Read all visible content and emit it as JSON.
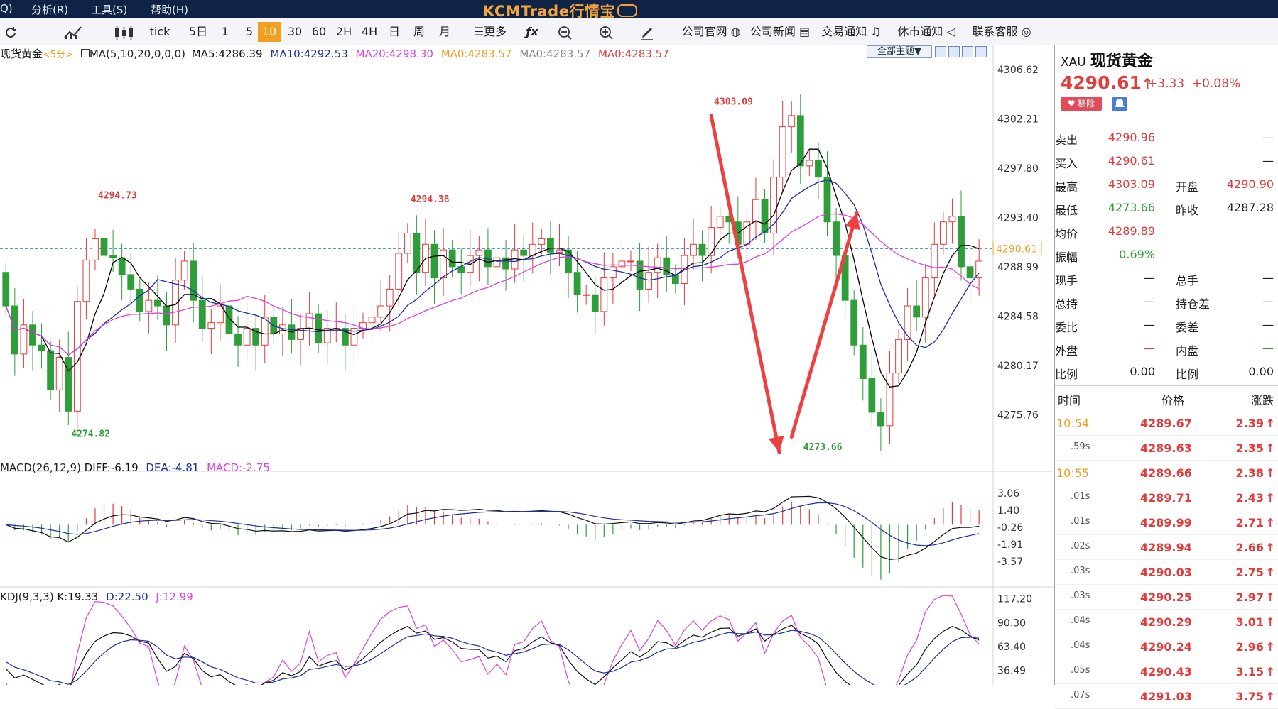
{
  "menubar": {
    "items": [
      "Q)",
      "分析(R)",
      "工具(S)",
      "帮助(H)"
    ],
    "brand": "KCMTrade行情宝"
  },
  "toolbar": {
    "periods": [
      "tick",
      "5日",
      "1",
      "5",
      "10",
      "30",
      "60",
      "2H",
      "4H",
      "日",
      "周",
      "月"
    ],
    "active_period": "10",
    "more": "更多",
    "links": [
      "公司官网",
      "公司新闻",
      "交易通知",
      "休市通知",
      "联系客服"
    ]
  },
  "price_legend": {
    "symbol": "现货黄金",
    "period": "<5分>",
    "ma_def": "MA(5,10,20,0,0,0)",
    "ma5": "MA5:4286.39",
    "ma10": "MA10:4292.53",
    "ma20": "MA20:4298.30",
    "ma0a": "MA0:4283.57",
    "ma0b": "MA0:4283.57",
    "ma0c": "MA0:4283.57",
    "theme_btn": "全部主题▼"
  },
  "macd_legend": {
    "def": "MACD(26,12,9)",
    "diff": "DIFF:-6.19",
    "dea": "DEA:-4.81",
    "macd": "MACD:-2.75"
  },
  "kdj_legend": {
    "def": "KDJ(9,3,3)",
    "k": "K:19.33",
    "d": "D:22.50",
    "j": "J:12.99"
  },
  "colors": {
    "up": "#e23b3b",
    "down": "#2e9e3a",
    "ma5": "#000000",
    "ma10": "#1a2fa8",
    "ma20": "#e040e0",
    "accent": "#f0a020",
    "header": "#0f2346"
  },
  "chart_data": {
    "type": "candlestick",
    "price_axis": {
      "ticks": [
        "4306.62",
        "4302.21",
        "4297.80",
        "4293.40",
        "4288.99",
        "4284.58",
        "4280.17",
        "4275.76"
      ],
      "current": "4290.61",
      "ylim": [
        4272.0,
        4307.5
      ]
    },
    "annotations": [
      {
        "label": "4294.73",
        "bar": 10,
        "price": 4294.73
      },
      {
        "label": "4274.82",
        "bar": 7,
        "price": 4274.82
      },
      {
        "label": "4294.38",
        "bar": 45,
        "price": 4294.38
      },
      {
        "label": "4303.09",
        "bar": 79,
        "price": 4303.09
      },
      {
        "label": "4273.66",
        "bar": 89,
        "price": 4273.66
      }
    ],
    "close": [
      4285.5,
      4281.2,
      4283.8,
      4282.0,
      4281.5,
      4278.0,
      4280.9,
      4276.1,
      4285.9,
      4289.6,
      4291.5,
      4290.0,
      4289.8,
      4288.3,
      4287.0,
      4285.0,
      4286.0,
      4285.5,
      4283.8,
      4287.8,
      4289.5,
      4286.0,
      4283.5,
      4284.0,
      4285.5,
      4283.0,
      4282.0,
      4283.5,
      4282.0,
      4284.5,
      4283.0,
      4283.8,
      4282.5,
      4283.5,
      4284.8,
      4282.2,
      4283.5,
      4283.5,
      4282.0,
      4283.5,
      4284.0,
      4284.5,
      4285.5,
      4287.0,
      4290.2,
      4292.0,
      4288.5,
      4291.0,
      4288.0,
      4290.5,
      4289.0,
      4288.5,
      4290.0,
      4290.5,
      4289.0,
      4289.8,
      4288.8,
      4290.5,
      4290.0,
      4291.0,
      4291.5,
      4290.3,
      4290.5,
      4288.5,
      4286.5,
      4286.5,
      4285.0,
      4288.0,
      4289.0,
      4289.5,
      4289.5,
      4287.0,
      4288.5,
      4289.8,
      4288.3,
      4287.5,
      4290.0,
      4291.0,
      4290.0,
      4292.5,
      4293.5,
      4293.0,
      4291.0,
      4293.0,
      4295.0,
      4292.0,
      4297.0,
      4301.5,
      4302.5,
      4298.0,
      4298.5,
      4297.0,
      4293.0,
      4290.0,
      4286.0,
      4282.0,
      4279.0,
      4276.0,
      4274.8,
      4279.5,
      4282.5,
      4285.5,
      4284.5,
      4288.0,
      4291.0,
      4293.0,
      4293.5,
      4289.0,
      4288.0,
      4289.5
    ],
    "open": [
      4288.5,
      4285.5,
      4281.2,
      4283.8,
      4282.0,
      4281.5,
      4278.0,
      4280.9,
      4276.1,
      4285.9,
      4289.6,
      4291.5,
      4290.0,
      4289.8,
      4288.3,
      4287.0,
      4285.0,
      4286.0,
      4285.5,
      4283.8,
      4287.8,
      4289.5,
      4286.0,
      4283.5,
      4284.0,
      4285.5,
      4283.0,
      4282.0,
      4283.5,
      4282.0,
      4284.5,
      4283.0,
      4283.8,
      4282.5,
      4283.5,
      4284.8,
      4282.2,
      4283.5,
      4283.5,
      4282.0,
      4283.5,
      4284.0,
      4284.5,
      4285.5,
      4287.0,
      4290.2,
      4292.0,
      4288.5,
      4291.0,
      4288.0,
      4290.5,
      4289.0,
      4288.5,
      4290.0,
      4290.5,
      4289.0,
      4289.8,
      4288.8,
      4290.5,
      4290.0,
      4291.0,
      4291.5,
      4290.3,
      4290.5,
      4288.5,
      4286.5,
      4286.5,
      4285.0,
      4288.0,
      4289.0,
      4289.5,
      4289.5,
      4287.0,
      4288.5,
      4289.8,
      4288.3,
      4287.5,
      4290.0,
      4291.0,
      4290.0,
      4292.5,
      4293.5,
      4293.0,
      4291.0,
      4293.0,
      4295.0,
      4292.0,
      4297.0,
      4301.5,
      4302.5,
      4298.0,
      4298.5,
      4297.0,
      4293.0,
      4290.0,
      4286.0,
      4282.0,
      4279.0,
      4276.0,
      4274.8,
      4279.5,
      4282.5,
      4285.5,
      4284.5,
      4288.0,
      4291.0,
      4293.0,
      4293.5,
      4289.0,
      4288.0
    ],
    "macd_axis": [
      "3.06",
      "1.40",
      "-0.26",
      "-1.91",
      "-3.57"
    ],
    "macd_ylim": [
      -5.0,
      4.5
    ],
    "kdj_axis": [
      "117.20",
      "90.30",
      "63.40",
      "36.49"
    ],
    "kdj_ylim": [
      20,
      125
    ]
  },
  "quote": {
    "code": "XAU",
    "name": "现货黄金",
    "price": "4290.61",
    "arrow": "↑",
    "change": "+3.33",
    "change_pct": "+0.08%",
    "remove_btn": "♥ 移除",
    "rows": [
      {
        "l1": "卖出",
        "v1": "4290.96",
        "l2": "",
        "v2": "—",
        "c1": "red",
        "c2": ""
      },
      {
        "l1": "买入",
        "v1": "4290.61",
        "l2": "",
        "v2": "—",
        "c1": "red",
        "c2": ""
      },
      {
        "l1": "最高",
        "v1": "4303.09",
        "l2": "开盘",
        "v2": "4290.90",
        "c1": "red",
        "c2": "red"
      },
      {
        "l1": "最低",
        "v1": "4273.66",
        "l2": "昨收",
        "v2": "4287.28",
        "c1": "green",
        "c2": ""
      },
      {
        "l1": "均价",
        "v1": "4289.89",
        "l2": "",
        "v2": "",
        "c1": "red",
        "c2": ""
      },
      {
        "l1": "振幅",
        "v1": "0.69%",
        "l2": "",
        "v2": "",
        "c1": "green",
        "c2": ""
      },
      {
        "l1": "现手",
        "v1": "—",
        "l2": "总手",
        "v2": "—",
        "c1": "",
        "c2": ""
      },
      {
        "l1": "总持",
        "v1": "—",
        "l2": "持仓差",
        "v2": "—",
        "c1": "",
        "c2": ""
      },
      {
        "l1": "委比",
        "v1": "—",
        "l2": "委差",
        "v2": "—",
        "c1": "",
        "c2": ""
      },
      {
        "l1": "外盘",
        "v1": "—",
        "l2": "内盘",
        "v2": "—",
        "c1": "red",
        "c2": "green"
      },
      {
        "l1": "比例",
        "v1": "0.00",
        "l2": "比例",
        "v2": "0.00",
        "c1": "",
        "c2": ""
      }
    ],
    "tick_header": {
      "time": "时间",
      "price": "价格",
      "change": "涨跌"
    },
    "ticks": [
      {
        "time": "10:54",
        "price": "4289.67",
        "change": "2.39",
        "hl": true
      },
      {
        "time": ".59s",
        "price": "4289.63",
        "change": "2.35",
        "hl": false
      },
      {
        "time": "10:55",
        "price": "4289.66",
        "change": "2.38",
        "hl": true
      },
      {
        "time": ".01s",
        "price": "4289.71",
        "change": "2.43",
        "hl": false
      },
      {
        "time": ".01s",
        "price": "4289.99",
        "change": "2.71",
        "hl": false
      },
      {
        "time": ".02s",
        "price": "4289.94",
        "change": "2.66",
        "hl": false
      },
      {
        "time": ".03s",
        "price": "4290.03",
        "change": "2.75",
        "hl": false
      },
      {
        "time": ".03s",
        "price": "4290.25",
        "change": "2.97",
        "hl": false
      },
      {
        "time": ".04s",
        "price": "4290.29",
        "change": "3.01",
        "hl": false
      },
      {
        "time": ".04s",
        "price": "4290.24",
        "change": "2.96",
        "hl": false
      },
      {
        "time": ".05s",
        "price": "4290.43",
        "change": "3.15",
        "hl": false
      },
      {
        "time": ".07s",
        "price": "4291.03",
        "change": "3.75",
        "hl": false
      }
    ]
  }
}
